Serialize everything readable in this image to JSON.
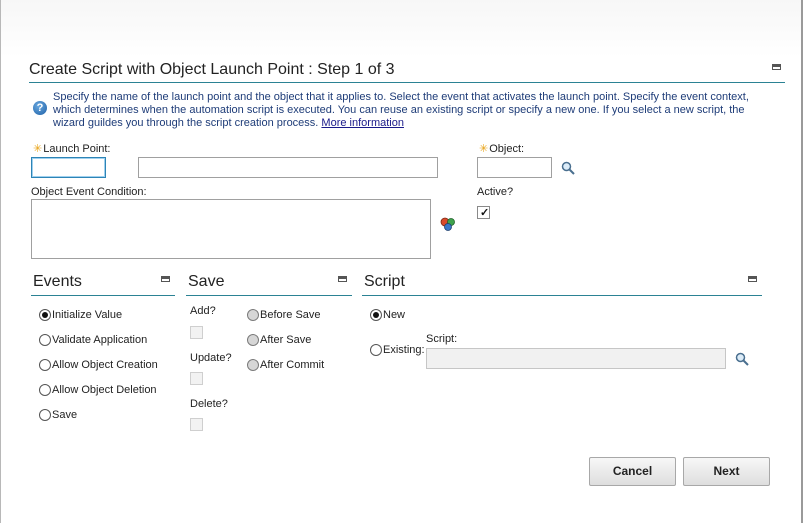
{
  "dialog": {
    "title": "Create Script with Object Launch Point : Step 1 of 3",
    "help_text": "Specify the name of the launch point and the object that it applies to. Select the event that activates the launch point. Specify the event context, which determines when the automation script is executed. You can reuse an existing script or specify a new one. If you select a new script, the wizard guildes you through the script creation process.",
    "help_link": "More information"
  },
  "form": {
    "launch_point_label": "Launch Point:",
    "launch_point_value": "",
    "launch_point_desc_value": "",
    "object_label": "Object:",
    "object_value": "",
    "condition_label": "Object Event Condition:",
    "condition_value": "",
    "active_label": "Active?",
    "active_checked": true
  },
  "events": {
    "title": "Events",
    "options": [
      "Initialize Value",
      "Validate Application",
      "Allow Object Creation",
      "Allow Object Deletion",
      "Save"
    ],
    "selected": "Initialize Value"
  },
  "save": {
    "title": "Save",
    "add_label": "Add?",
    "update_label": "Update?",
    "delete_label": "Delete?",
    "options": [
      "Before Save",
      "After Save",
      "After Commit"
    ]
  },
  "script": {
    "title": "Script",
    "new_label": "New",
    "existing_label": "Existing:",
    "script_label": "Script:",
    "script_value": "",
    "selected": "New"
  },
  "buttons": {
    "cancel": "Cancel",
    "next": "Next"
  }
}
